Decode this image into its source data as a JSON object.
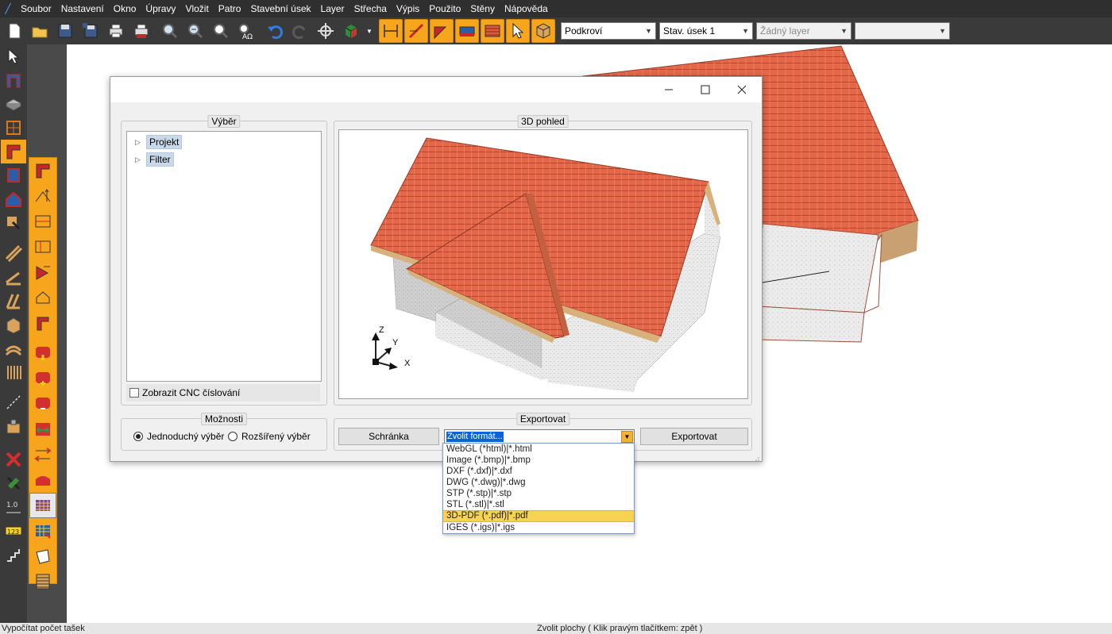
{
  "menu": [
    "Soubor",
    "Nastavení",
    "Okno",
    "Úpravy",
    "Vložit",
    "Patro",
    "Stavební úsek",
    "Layer",
    "Střecha",
    "Výpis",
    "Použito",
    "Stěny",
    "Nápověda"
  ],
  "toolbar": {
    "floor_select": "Podkroví",
    "section_select": "Stav. úsek 1",
    "layer_select": "Žádný layer",
    "extra_select": ""
  },
  "dialog": {
    "selection_group": "Výběr",
    "tree_items": [
      "Projekt",
      "Filter"
    ],
    "cnc_checkbox_label": "Zobrazit CNC číslování",
    "view_group": "3D pohled",
    "axes": {
      "z": "Z",
      "y": "Y",
      "x": "X"
    },
    "options_group": "Možnosti",
    "radio_simple": "Jednoduchý výběr",
    "radio_extended": "Rozšířený výběr",
    "export_group": "Exportovat",
    "clipboard_button": "Schránka",
    "format_combo_value": "Zvolit formát...",
    "export_button": "Exportovat",
    "formats": [
      "WebGL (*html)|*.html",
      "Image (*.bmp)|*.bmp",
      "DXF (*.dxf)|*.dxf",
      "DWG (*.dwg)|*.dwg",
      "STP (*.stp)|*.stp",
      "STL (*.stl)|*.stl",
      "3D-PDF (*.pdf)|*.pdf",
      "IGES (*.igs)|*.igs"
    ],
    "highlighted_format_index": 6
  },
  "status": {
    "left": "Vypočítat počet tašek",
    "center": "Zvolit plochy ( Klik pravým tlačítkem: zpět )"
  },
  "colors": {
    "accent_toolbar": "#f7a51c",
    "roof_tile": "#e06a4a",
    "wall": "#e9e9e9",
    "selection_blue": "#0a64d8"
  }
}
